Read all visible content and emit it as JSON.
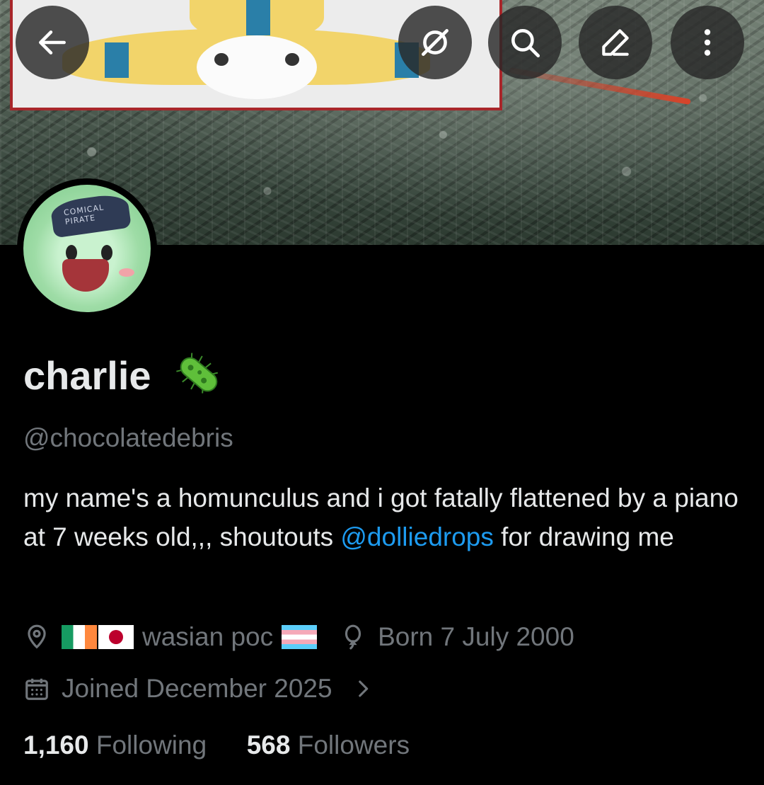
{
  "profile": {
    "display_name": "charlie",
    "name_badge_icon": "microbe-icon",
    "handle": "@chocolatedebris",
    "bio": {
      "before_mention": "my name's a homunculus and i got fatally flattened by a piano at 7 weeks old,,, shoutouts ",
      "mention": "@dolliedrops",
      "after_mention": " for drawing me"
    },
    "location": {
      "icon": "location-pin-icon",
      "flags": [
        "flag-ireland",
        "flag-japan"
      ],
      "text": "wasian poc",
      "trailing_flag": "flag-transgender"
    },
    "birthday": {
      "icon": "balloon-icon",
      "text": "Born 7 July 2000"
    },
    "joined": {
      "icon": "calendar-icon",
      "text": "Joined December 2025",
      "chevron": "chevron-right-icon"
    },
    "following_count": "1,160",
    "following_label": "Following",
    "followers_count": "568",
    "followers_label": "Followers"
  },
  "toolbar": {
    "back_icon": "back-arrow-icon",
    "grok_icon": "grok-icon",
    "search_icon": "search-icon",
    "edit_icon": "edit-pencil-icon",
    "more_icon": "more-vertical-icon"
  },
  "avatar": {
    "cap_text": "COMICAL PIRATE"
  },
  "colors": {
    "background": "#000000",
    "primary_text": "#e7e9ea",
    "secondary_text": "#71767b",
    "link": "#1d9bf0"
  }
}
